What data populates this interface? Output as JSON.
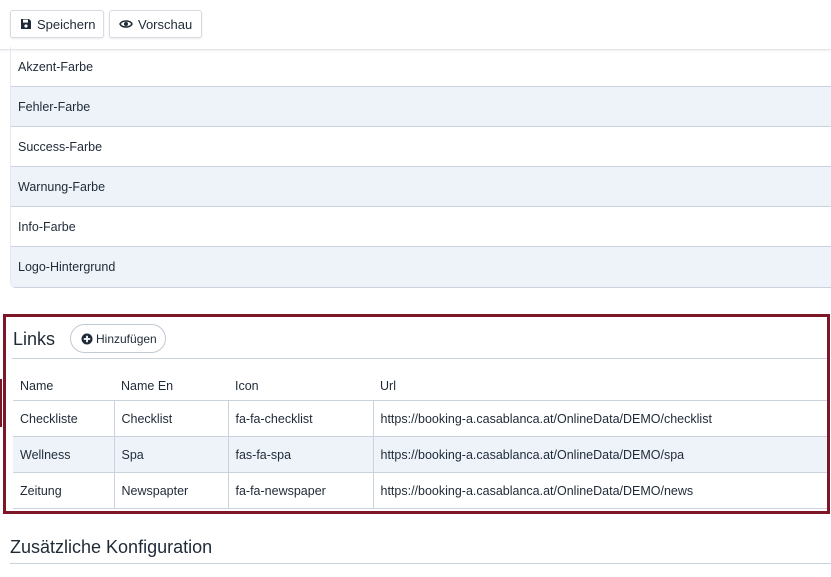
{
  "toolbar": {
    "save_label": "Speichern",
    "save_icon": "floppy-disk-icon",
    "preview_label": "Vorschau",
    "preview_icon": "eye-icon"
  },
  "colors": {
    "items": [
      {
        "label": "Akzent-Farbe"
      },
      {
        "label": "Fehler-Farbe"
      },
      {
        "label": "Success-Farbe"
      },
      {
        "label": "Warnung-Farbe"
      },
      {
        "label": "Info-Farbe"
      },
      {
        "label": "Logo-Hintergrund"
      }
    ]
  },
  "links": {
    "title": "Links",
    "add_label": "Hinzufügen",
    "add_icon": "plus-circle-icon",
    "columns": [
      "Name",
      "Name En",
      "Icon",
      "Url"
    ],
    "rows": [
      {
        "name": "Checkliste",
        "name_en": "Checklist",
        "icon": "fa-fa-checklist",
        "url": "https://booking-a.casablanca.at/OnlineData/DEMO/checklist"
      },
      {
        "name": "Wellness",
        "name_en": "Spa",
        "icon": "fas-fa-spa",
        "url": "https://booking-a.casablanca.at/OnlineData/DEMO/spa"
      },
      {
        "name": "Zeitung",
        "name_en": "Newspapter",
        "icon": "fa-fa-newspaper",
        "url": "https://booking-a.casablanca.at/OnlineData/DEMO/news"
      }
    ]
  },
  "extra": {
    "title": "Zusätzliche Konfiguration"
  },
  "theme": {
    "highlight_border": "#7d1626",
    "row_alt_bg": "#eef3f9",
    "divider": "#c9d2dd"
  }
}
